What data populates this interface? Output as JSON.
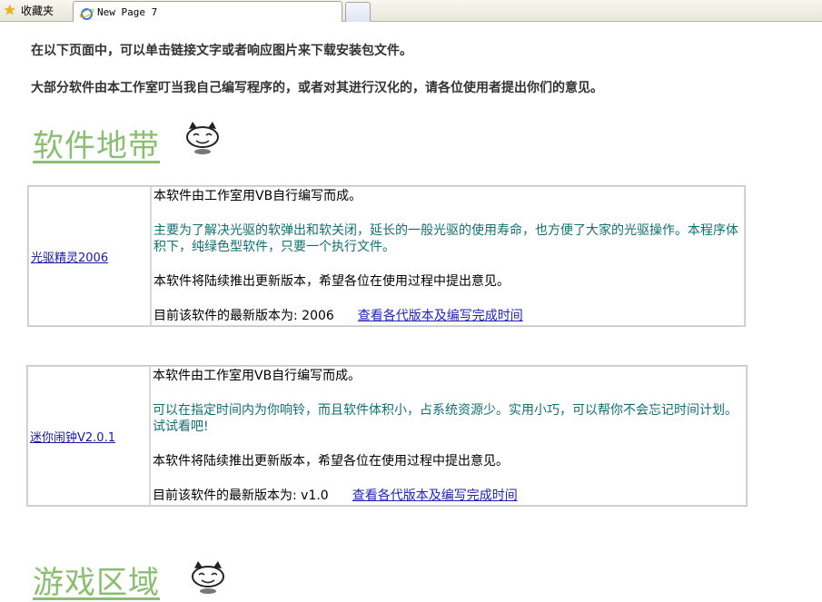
{
  "browser": {
    "favorites_label": "收藏夹",
    "tab_title": "New Page 7"
  },
  "intro": {
    "line1": "在以下页面中，可以单击链接文字或者响应图片来下载安装包文件。",
    "line2": "大部分软件由本工作室叮当我自己编写程序的，或者对其进行汉化的，请各位使用者提出你们的意见。"
  },
  "sections": [
    {
      "title": "软件地带"
    },
    {
      "title": "游戏区域"
    }
  ],
  "software": [
    {
      "name": "光驱精灵2006",
      "line1": "本软件由工作室用VB自行编写而成。",
      "description": "主要为了解决光驱的软弹出和软关闭，延长的一般光驱的使用寿命，也方便了大家的光驱操作。本程序体积下，纯绿色型软件，只要一个执行文件。",
      "update_note": "本软件将陆续推出更新版本，希望各位在使用过程中提出意见。",
      "version_text": "目前该软件的最新版本为: 2006",
      "version_link": "查看各代版本及编写完成时间"
    },
    {
      "name": "迷你闹钟V2.0.1",
      "line1": "本软件由工作室用VB自行编写而成。",
      "description": "可以在指定时间内为你响铃，而且软件体积小，占系统资源少。实用小巧，可以帮你不会忘记时间计划。试试看吧!",
      "update_note": "本软件将陆续推出更新版本，希望各位在使用过程中提出意见。",
      "version_text": "目前该软件的最新版本为: v1.0",
      "version_link": "查看各代版本及编写完成时间"
    }
  ]
}
